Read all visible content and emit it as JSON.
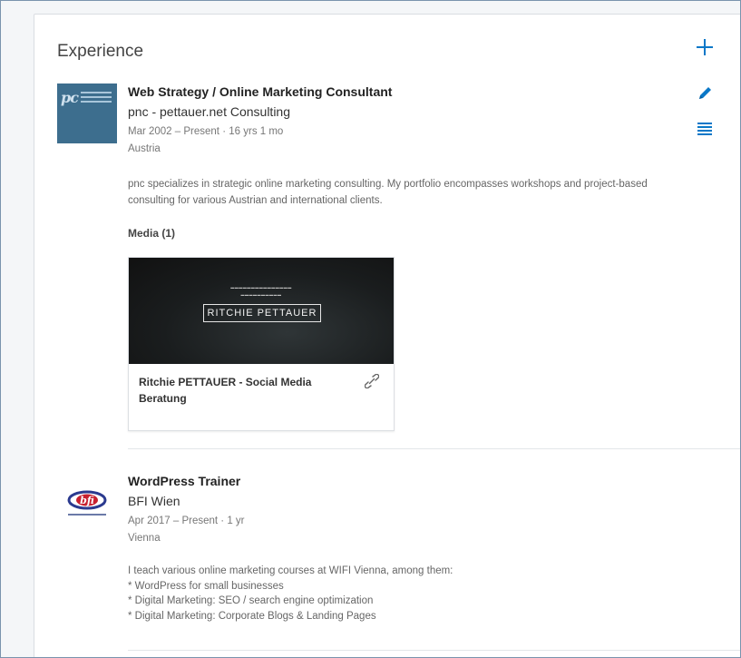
{
  "section": {
    "title": "Experience"
  },
  "icons": {
    "add": "plus-icon",
    "edit": "pencil-icon",
    "reorder": "list-icon",
    "link": "link-icon"
  },
  "colors": {
    "accent": "#0a78c8",
    "pnc_logo_bg": "#3d6e8e",
    "bfi_logo": "#2b3a8f"
  },
  "entries": [
    {
      "logo": "pnc",
      "title": "Web Strategy / Online Marketing Consultant",
      "company": "pnc - pettauer.net Consulting",
      "dates": "Mar 2002 – Present",
      "duration": "16 yrs 1 mo",
      "location": "Austria",
      "description": "pnc specializes in strategic online marketing consulting. My portfolio encompasses workshops and project-based consulting for various Austrian and international clients.",
      "media_label": "Media (1)",
      "media": {
        "thumb_name": "RITCHIE PETTAUER",
        "title": "Ritchie PETTAUER - Social Media Beratung"
      }
    },
    {
      "logo": "bfi",
      "title": "WordPress Trainer",
      "company": "BFI Wien",
      "dates": "Apr 2017 – Present",
      "duration": "1 yr",
      "location": "Vienna",
      "description_lines": [
        "I teach various online marketing courses at WIFI Vienna, among them:",
        "* WordPress for small businesses",
        "* Digital Marketing: SEO / search engine optimization",
        "* Digital Marketing: Corporate Blogs & Landing Pages"
      ]
    }
  ]
}
